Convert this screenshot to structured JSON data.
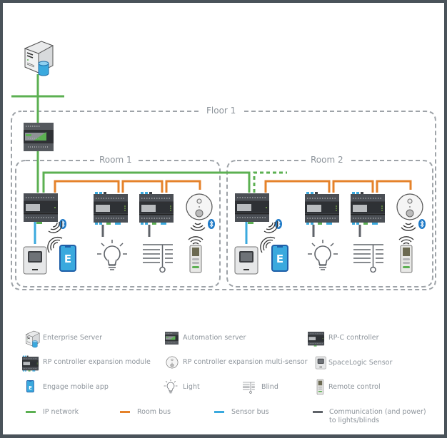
{
  "diagram": {
    "floor_label": "Floor 1",
    "rooms": [
      {
        "label": "Room 1"
      },
      {
        "label": "Room 2"
      }
    ],
    "colors": {
      "ip_network": "#5cb052",
      "room_bus": "#e5822a",
      "sensor_bus": "#3aa9de",
      "comm_power": "#5f6369",
      "dashed_border": "#9ea3a8",
      "bluetooth": "#1f7ac7"
    },
    "engage_app_letter": "E"
  },
  "legend": {
    "items": [
      {
        "icon": "enterprise-server-icon",
        "label": "Enterprise Server"
      },
      {
        "icon": "automation-server-icon",
        "label": "Automation server"
      },
      {
        "icon": "rp-c-controller-icon",
        "label": "RP-C controller"
      },
      {
        "icon": "rp-expansion-module-icon",
        "label": "RP controller expansion module"
      },
      {
        "icon": "multi-sensor-icon",
        "label": "RP controller expansion multi-sensor"
      },
      {
        "icon": "spacelogic-sensor-icon",
        "label": "SpaceLogic Sensor"
      },
      {
        "icon": "engage-app-icon",
        "label": "Engage mobile app"
      },
      {
        "icon": "light-icon",
        "label": "Light"
      },
      {
        "icon": "blind-icon",
        "label": "Blind"
      },
      {
        "icon": "remote-control-icon",
        "label": "Remote control"
      }
    ],
    "lines": [
      {
        "name": "ip-network",
        "label": "IP network",
        "color": "#5cb052"
      },
      {
        "name": "room-bus",
        "label": "Room bus",
        "color": "#e5822a"
      },
      {
        "name": "sensor-bus",
        "label": "Sensor bus",
        "color": "#3aa9de"
      },
      {
        "name": "comm-power",
        "label": "Communication (and power) to lights/blinds",
        "color": "#5f6369"
      }
    ],
    "comm_line1": "Communication (and power)",
    "comm_line2": "to lights/blinds"
  }
}
